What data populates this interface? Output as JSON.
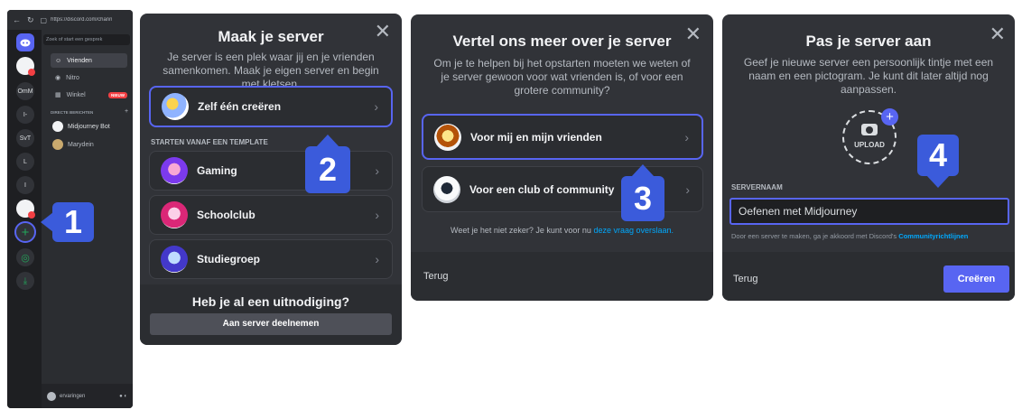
{
  "browser": {
    "url": "https://discord.com/chann"
  },
  "sidebar": {
    "search_placeholder": "Zoek of start een gesprek",
    "guilds": [
      "OmM",
      "I-",
      "SvT",
      "L",
      "I"
    ],
    "nav": [
      {
        "label": "Vrienden"
      },
      {
        "label": "Nitro"
      },
      {
        "label": "Winkel",
        "badge": "NIEUW"
      }
    ],
    "dm_header": "DIRECTE BERICHTEN",
    "dms": [
      "Midjourney Bot",
      "Marydein"
    ],
    "user_name": "ervaringen"
  },
  "step_badges": [
    "1",
    "2",
    "3",
    "4"
  ],
  "panel1": {
    "title": "Maak je server",
    "subtitle": "Je server is een plek waar jij en je vrienden samenkomen. Maak je eigen server en begin met kletsen.",
    "create_own": "Zelf één creëren",
    "template_header": "STARTEN VANAF EEN TEMPLATE",
    "templates": [
      "Gaming",
      "Schoolclub",
      "Studiegroep"
    ],
    "invite_heading": "Heb je al een uitnodiging?",
    "join_button": "Aan server deelnemen"
  },
  "panel2": {
    "title": "Vertel ons meer over je server",
    "subtitle": "Om je te helpen bij het opstarten moeten we weten of je server gewoon voor wat vrienden is, of voor een grotere community?",
    "options": [
      "Voor mij en mijn vrienden",
      "Voor een club of community"
    ],
    "unsure_text": "Weet je het niet zeker? Je kunt voor nu",
    "skip_link": "deze vraag overslaan.",
    "back": "Terug"
  },
  "panel3": {
    "title": "Pas je server aan",
    "subtitle": "Geef je nieuwe server een persoonlijk tintje met een naam en een pictogram. Je kunt dit later altijd nog aanpassen.",
    "upload_label": "UPLOAD",
    "name_label": "SERVERNAAM",
    "name_value": "Oefenen met Midjourney",
    "agree_text": "Door een server te maken, ga je akkoord met Discord's",
    "agree_link": "Communityrichtlijnen",
    "back": "Terug",
    "create": "Creëren"
  },
  "colors": {
    "accent": "#5865f2",
    "badge": "#3b5bdb",
    "panel": "#313338",
    "link": "#00a8fc"
  }
}
